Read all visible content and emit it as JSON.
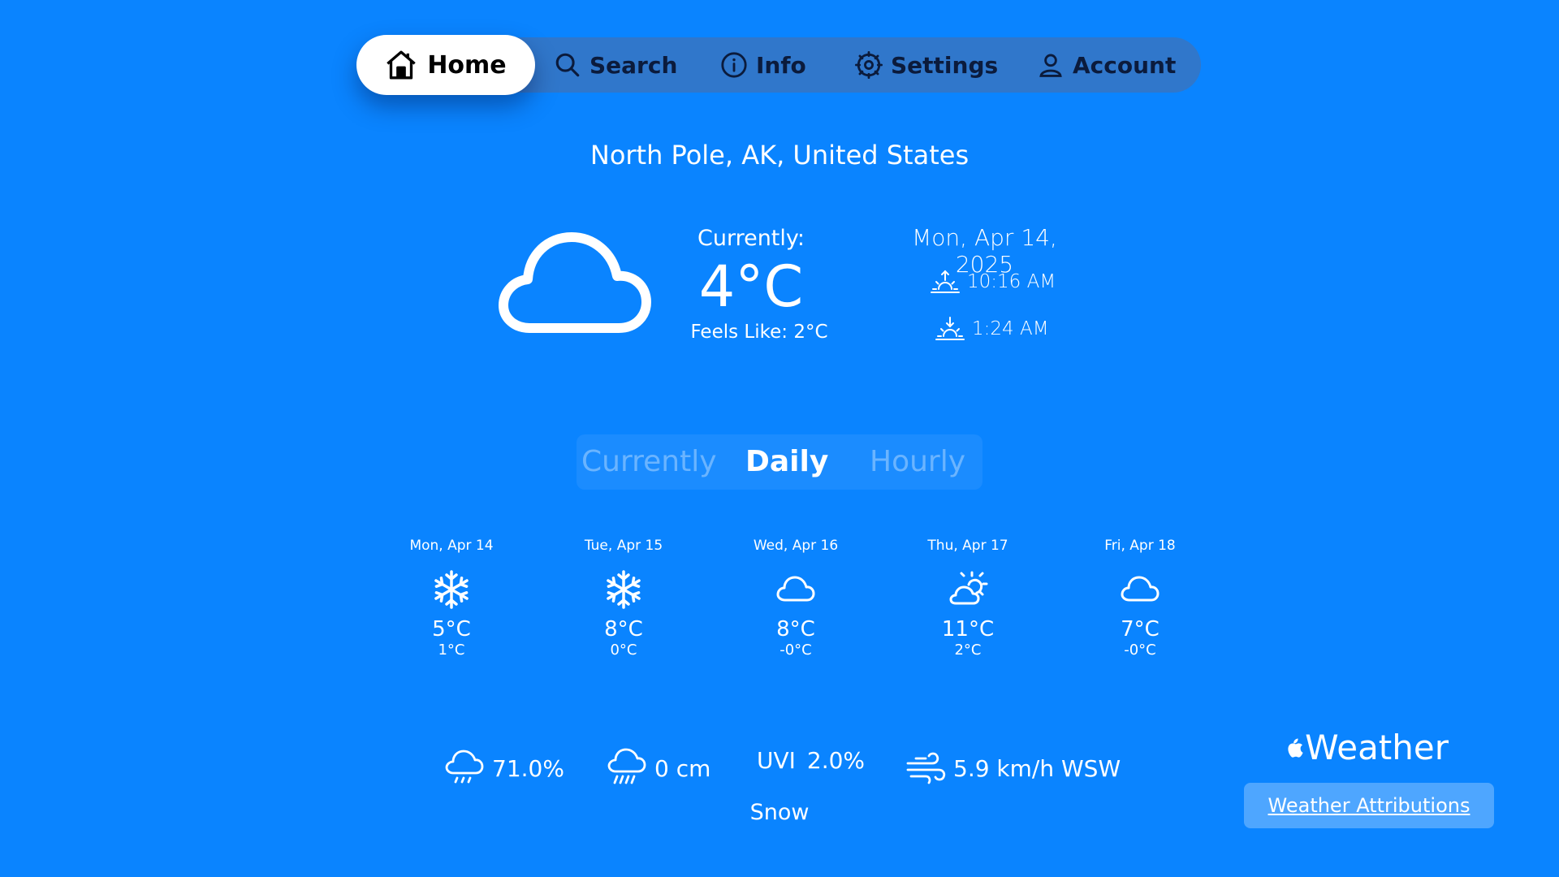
{
  "nav": {
    "home": "Home",
    "search": "Search",
    "info": "Info",
    "settings": "Settings",
    "account": "Account"
  },
  "location": "North Pole, AK, United States",
  "current": {
    "label": "Currently:",
    "temp": "4°C",
    "feels_like": "Feels Like: 2°C",
    "date": "Mon, Apr 14, 2025",
    "sunrise": "10:16 AM",
    "sunset": "1:24 AM",
    "icon": "cloud-icon"
  },
  "tabs": {
    "currently": "Currently",
    "daily": "Daily",
    "hourly": "Hourly",
    "selected": "Daily"
  },
  "forecast": [
    {
      "date": "Mon, Apr 14",
      "icon": "snowflake-icon",
      "high": "5°C",
      "low": "1°C"
    },
    {
      "date": "Tue, Apr 15",
      "icon": "snowflake-icon",
      "high": "8°C",
      "low": "0°C"
    },
    {
      "date": "Wed, Apr 16",
      "icon": "cloud-icon",
      "high": "8°C",
      "low": "-0°C"
    },
    {
      "date": "Thu, Apr 17",
      "icon": "partly-sunny-icon",
      "high": "11°C",
      "low": "2°C"
    },
    {
      "date": "Fri, Apr 18",
      "icon": "cloud-icon",
      "high": "7°C",
      "low": "-0°C"
    }
  ],
  "stats": {
    "precip_chance": "71.0%",
    "precip_amount": "0 cm",
    "uvi_label": "UVI",
    "uvi_value": "2.0%",
    "wind": "5.9 km/h WSW",
    "condition": "Snow"
  },
  "attribution": {
    "logo_text": "Weather",
    "link": "Weather Attributions"
  },
  "colors": {
    "background": "#0a84ff",
    "nav_bar": "#506ea0",
    "text": "#ffffff"
  }
}
